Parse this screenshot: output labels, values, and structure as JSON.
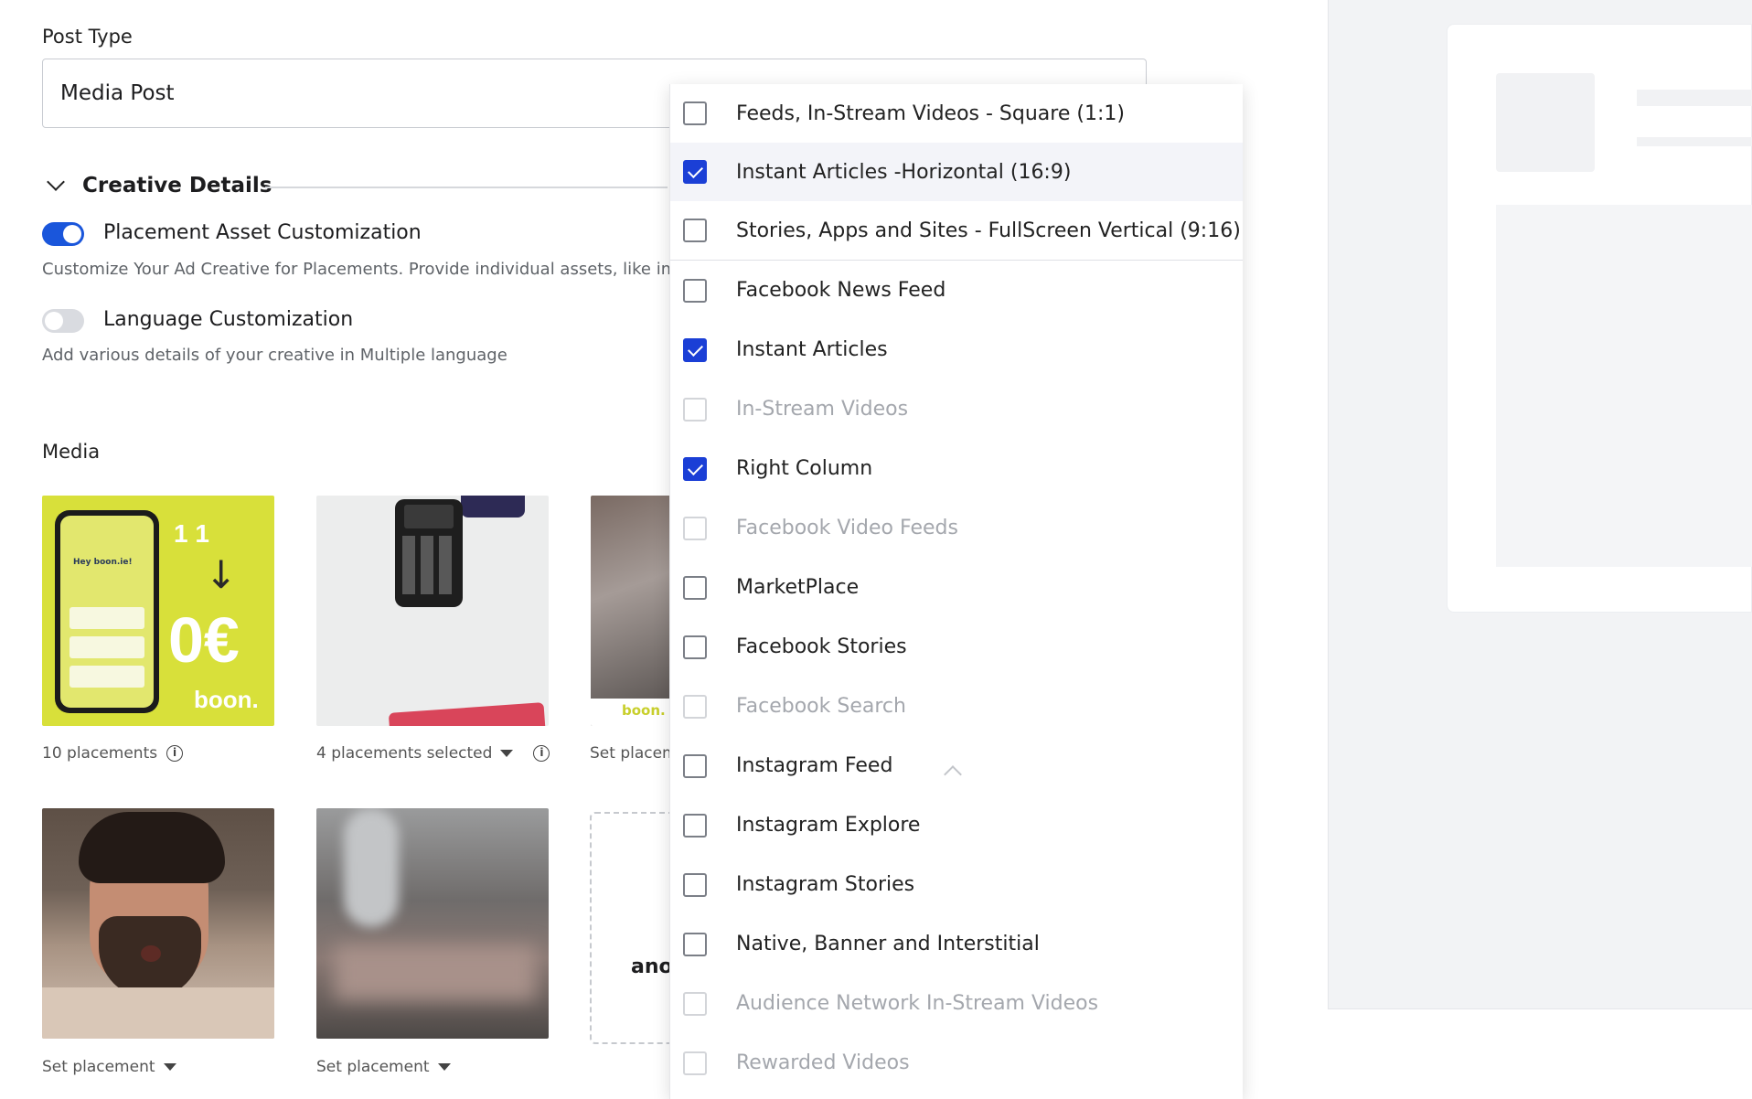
{
  "form": {
    "post_type_label": "Post Type",
    "post_type_value": "Media Post",
    "creative_details_title": "Creative Details",
    "placement_toggle": {
      "label": "Placement Asset Customization",
      "description": "Customize Your Ad Creative for Placements. Provide individual assets, like image",
      "on": true
    },
    "language_toggle": {
      "label": "Language Customization",
      "description": "Add various details of your creative in Multiple language",
      "on": false
    },
    "media_title": "Media"
  },
  "media": [
    {
      "caption": "10 placements",
      "has_info": true,
      "has_caret": false
    },
    {
      "caption": "4 placements selected",
      "has_info": true,
      "has_caret": true
    },
    {
      "caption": "Set placem",
      "has_info": false,
      "has_caret": false
    },
    {
      "caption": "Set placement",
      "has_info": false,
      "has_caret": true
    },
    {
      "caption": "Set placement",
      "has_info": false,
      "has_caret": true
    }
  ],
  "media_art": {
    "t1_num": "1 1",
    "t1_big": "0€",
    "t1_logo": "boon.",
    "t1_hey": "Hey boon.ie!",
    "t3_logo": "boon."
  },
  "add_media_partial_text": "ano",
  "dropdown": {
    "formats": [
      {
        "label": "Feeds, In-Stream Videos - Square (1:1)",
        "checked": false,
        "disabled": false,
        "highlighted": false
      },
      {
        "label": "Instant Articles -Horizontal (16:9)",
        "checked": true,
        "disabled": false,
        "highlighted": true
      },
      {
        "label": "Stories, Apps and Sites - FullScreen Vertical (9:16)",
        "checked": false,
        "disabled": false,
        "highlighted": false
      }
    ],
    "placements": [
      {
        "label": "Facebook News Feed",
        "checked": false,
        "disabled": false
      },
      {
        "label": "Instant Articles",
        "checked": true,
        "disabled": false
      },
      {
        "label": "In-Stream Videos",
        "checked": false,
        "disabled": true
      },
      {
        "label": "Right Column",
        "checked": true,
        "disabled": false
      },
      {
        "label": "Facebook Video Feeds",
        "checked": false,
        "disabled": true
      },
      {
        "label": "MarketPlace",
        "checked": false,
        "disabled": false
      },
      {
        "label": "Facebook Stories",
        "checked": false,
        "disabled": false
      },
      {
        "label": "Facebook Search",
        "checked": false,
        "disabled": true
      },
      {
        "label": "Instagram Feed",
        "checked": false,
        "disabled": false
      },
      {
        "label": "Instagram Explore",
        "checked": false,
        "disabled": false
      },
      {
        "label": "Instagram Stories",
        "checked": false,
        "disabled": false
      },
      {
        "label": "Native, Banner and Interstitial",
        "checked": false,
        "disabled": false
      },
      {
        "label": "Audience Network In-Stream Videos",
        "checked": false,
        "disabled": true
      },
      {
        "label": "Rewarded Videos",
        "checked": false,
        "disabled": true
      }
    ]
  },
  "colors": {
    "accent": "#1b3fd6",
    "toggle_on": "#1a56db",
    "toggle_off": "#d9dbe0",
    "disabled_text": "#a4a7ad"
  }
}
